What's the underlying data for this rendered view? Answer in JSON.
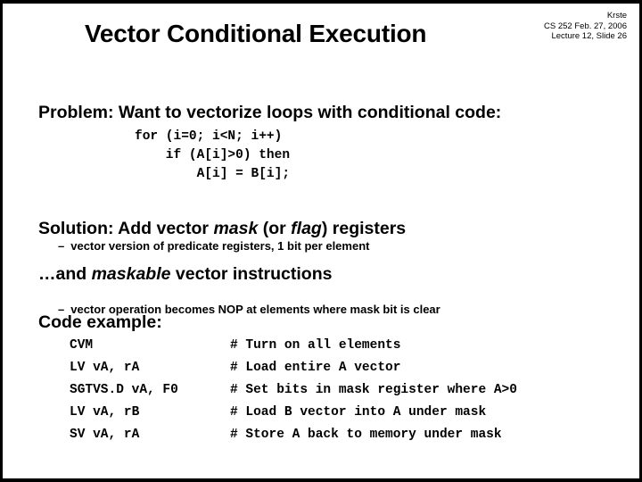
{
  "header": {
    "title": "Vector Conditional Execution",
    "author": "Krste",
    "course_date": "CS 252 Feb. 27, 2006",
    "lecture_slide": "Lecture 12, Slide 26"
  },
  "body": {
    "problem_line": "Problem: Want to vectorize loops with conditional code:",
    "c_code": "for (i=0; i<N; i++)\n    if (A[i]>0) then\n        A[i] = B[i];",
    "solution_pre": "Solution: Add vector ",
    "solution_em1": "mask",
    "solution_mid": " (or ",
    "solution_em2": "flag",
    "solution_post": ") registers",
    "sub_bullet_1_dash": "–",
    "sub_bullet_1": "vector version of predicate registers, 1 bit per element",
    "and_maskable_pre": "…and ",
    "and_maskable_em": "maskable",
    "and_maskable_post": " vector instructions",
    "sub_bullet_2_dash": "–",
    "sub_bullet_2": "vector operation becomes NOP at elements where mask bit is clear",
    "code_example_heading": "Code example:"
  },
  "asm_code": [
    {
      "instruction": "CVM",
      "comment": "# Turn on all elements"
    },
    {
      "instruction": "LV vA, rA",
      "comment": "# Load entire A vector"
    },
    {
      "instruction": "SGTVS.D vA, F0",
      "comment": "# Set bits in mask register where A>0"
    },
    {
      "instruction": "LV vA, rB",
      "comment": "# Load B vector into A under mask"
    },
    {
      "instruction": "SV vA, rA",
      "comment": "# Store A back to memory under mask"
    }
  ],
  "colors": {
    "background": "#ffffff",
    "text": "#000000",
    "border": "#000000"
  }
}
